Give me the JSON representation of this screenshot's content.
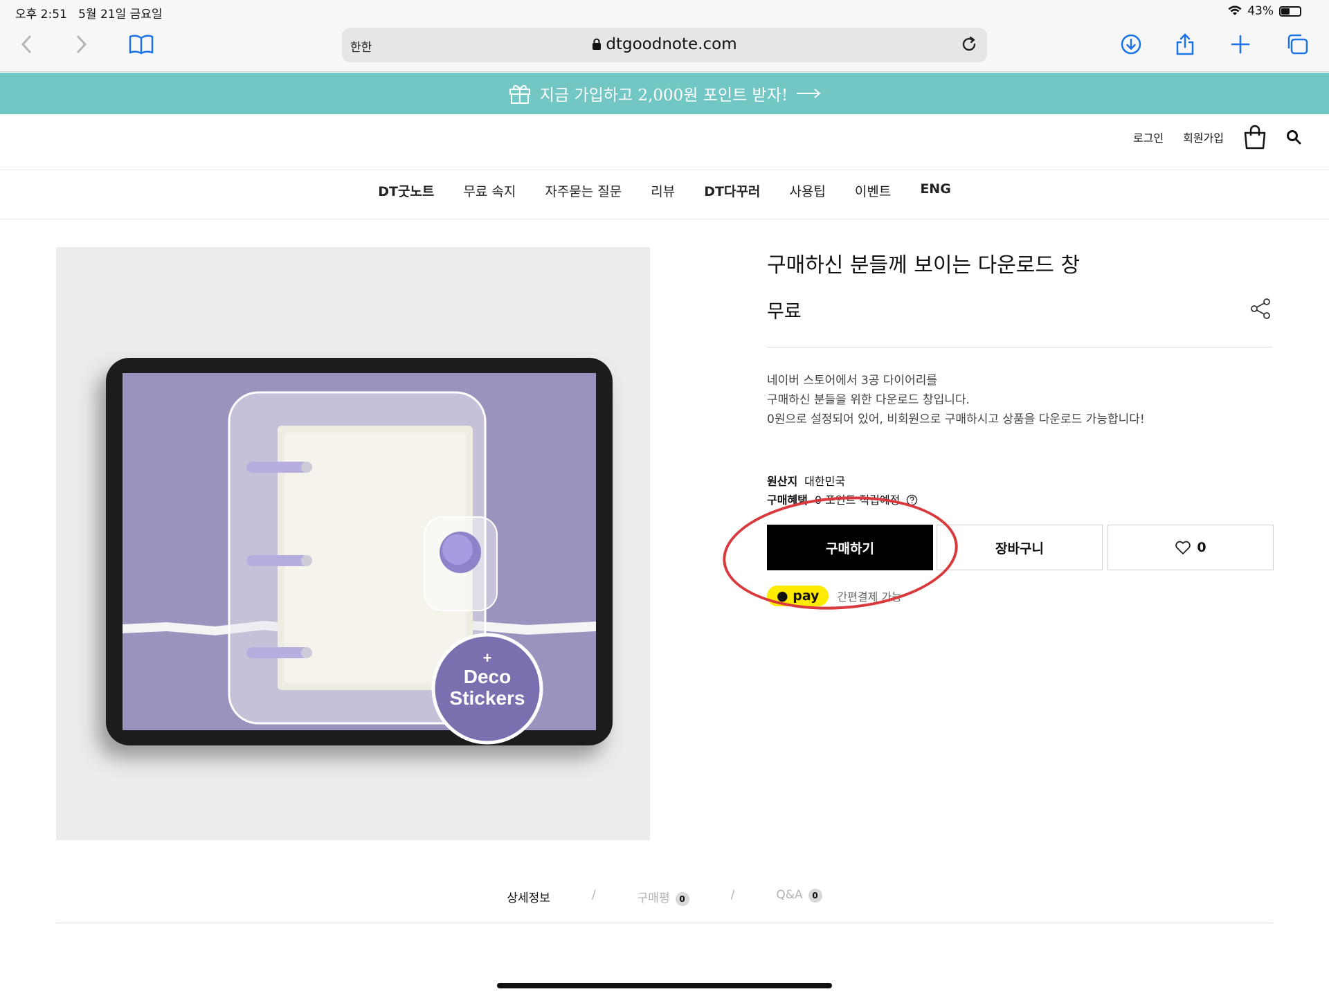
{
  "status": {
    "time": "오후 2:51",
    "date": "5월 21일 금요일",
    "battery": "43%"
  },
  "browser": {
    "aa_label": "한한",
    "domain": "dtgoodnote.com"
  },
  "promo": {
    "text": "지금 가입하고 2,000원 포인트 받자!"
  },
  "util_nav": {
    "login": "로그인",
    "signup": "회원가입"
  },
  "gnb": [
    "DT굿노트",
    "무료 속지",
    "자주묻는 질문",
    "리뷰",
    "DT다꾸러",
    "사용팁",
    "이벤트",
    "ENG"
  ],
  "product": {
    "image_badge_plus": "+",
    "image_badge_line1": "Deco",
    "image_badge_line2": "Stickers",
    "title": "구매하신 분들께 보이는 다운로드 창",
    "price": "무료",
    "description": [
      "네이버 스토어에서 3공 다이어리를",
      "구매하신 분들을 위한 다운로드 창입니다.",
      "0원으로 설정되어 있어, 비회원으로 구매하시고 상품을 다운로드 가능합니다!"
    ],
    "origin_label": "원산지",
    "origin_value": "대한민국",
    "benefit_label": "구매혜택",
    "benefit_value": "0 포인트 적립예정",
    "buy_button": "구매하기",
    "cart_button": "장바구니",
    "like_count": "0",
    "pay_badge": "pay",
    "pay_text": "간편결제 가능"
  },
  "tabs": {
    "detail": "상세정보",
    "sep": "/",
    "review": "구매평",
    "review_count": "0",
    "qna": "Q&A",
    "qna_count": "0"
  },
  "colors": {
    "promo_bg": "#72c6c3",
    "annotation_circle": "#d9383c",
    "tablet_screen": "#9b93bd",
    "pay_yellow": "#ffeb00"
  }
}
